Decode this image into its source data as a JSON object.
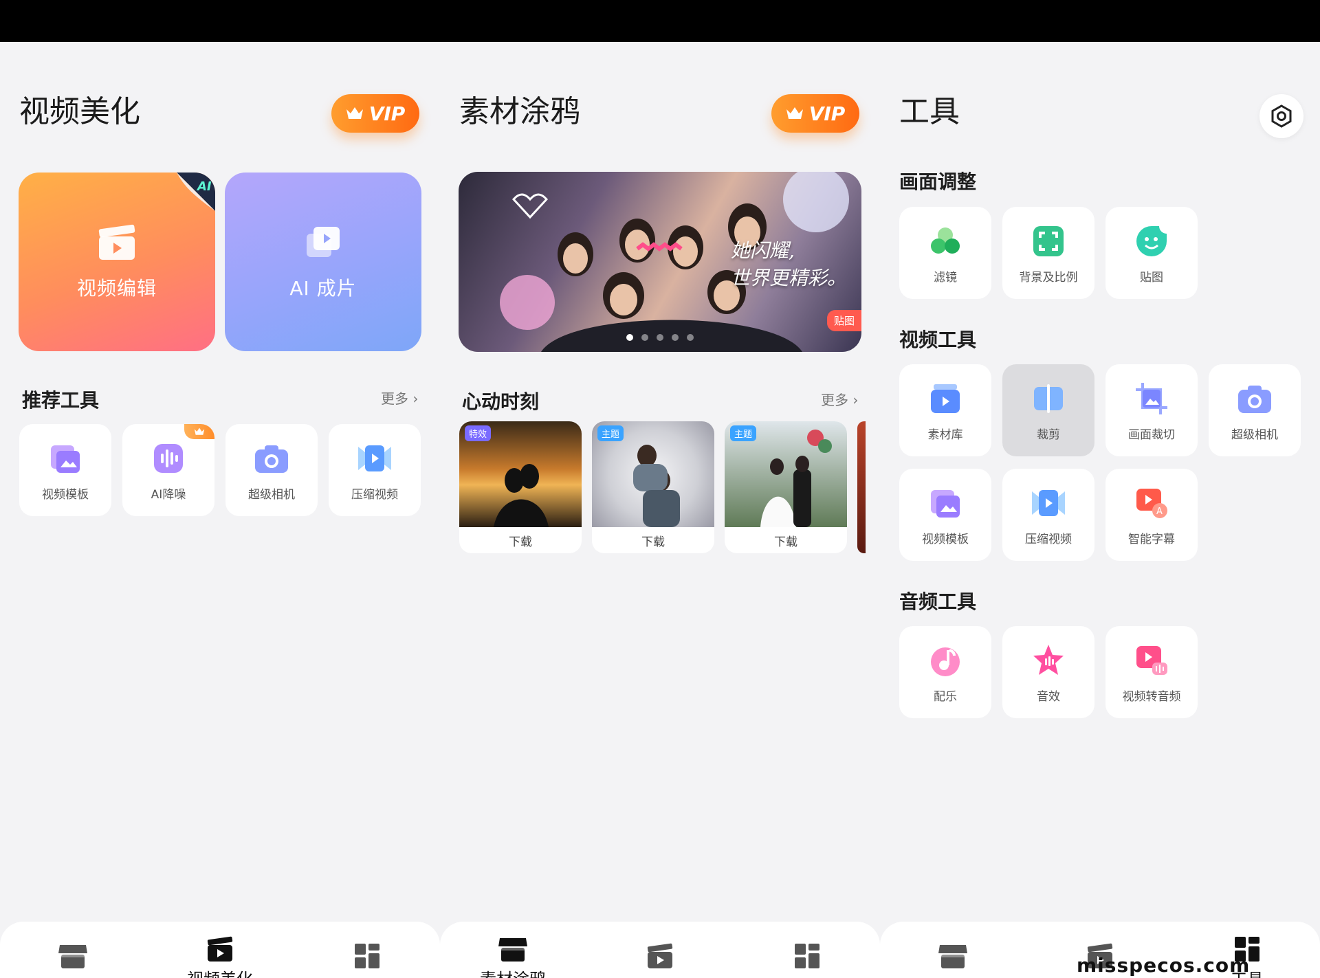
{
  "panel1": {
    "title": "视频美化",
    "vip_label": "VIP",
    "card_edit": "视频编辑",
    "card_ai": "AI 成片",
    "ai_corner": "AI",
    "section_title": "推荐工具",
    "more": "更多",
    "tools": [
      "视频模板",
      "AI降噪",
      "超级相机",
      "压缩视频"
    ]
  },
  "panel2": {
    "title": "素材涂鸦",
    "vip_label": "VIP",
    "banner_text_line1": "她闪耀,",
    "banner_text_line2": "世界更精彩。",
    "banner_tag": "贴图",
    "section_title": "心动时刻",
    "more": "更多",
    "moments": [
      {
        "badge": "特效",
        "action": "下载"
      },
      {
        "badge": "主题",
        "action": "下载"
      },
      {
        "badge": "主题",
        "action": "下载"
      }
    ]
  },
  "panel3": {
    "title": "工具",
    "sections": {
      "picture": {
        "title": "画面调整",
        "items": [
          "滤镜",
          "背景及比例",
          "贴图"
        ]
      },
      "video": {
        "title": "视频工具",
        "items": [
          "素材库",
          "裁剪",
          "画面裁切",
          "超级相机",
          "视频模板",
          "压缩视频",
          "智能字幕"
        ]
      },
      "audio": {
        "title": "音频工具",
        "items": [
          "配乐",
          "音效",
          "视频转音频"
        ]
      }
    }
  },
  "nav": {
    "panel1_active": "视频美化",
    "panel2_active": "素材涂鸦",
    "panel3_active": "工具"
  },
  "watermark": "misspecos.com",
  "colors": {
    "vip_gradient": [
      "#ff9d2e",
      "#ff6a12"
    ],
    "edit_card": "#ff8d5d",
    "ai_card": "#97a5fb"
  }
}
